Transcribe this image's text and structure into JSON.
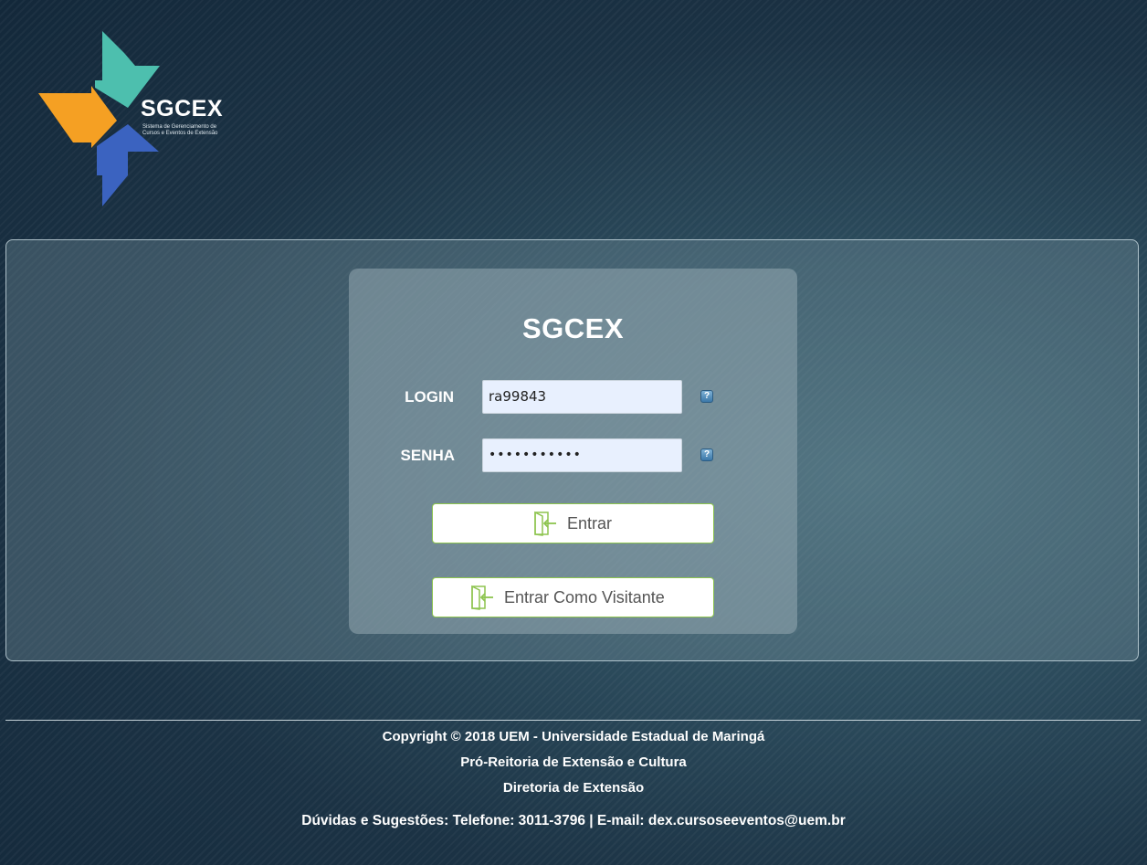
{
  "logo": {
    "title": "SGCEX",
    "subtitle": "Sistema de Gerenciamento de Cursos e Eventos de Extensão",
    "colors": {
      "teal": "#4dbfae",
      "orange": "#f5a023",
      "blue": "#3b63c0"
    }
  },
  "login_form": {
    "title": "SGCEX",
    "login_label": "LOGIN",
    "login_value": "ra99843",
    "senha_label": "SENHA",
    "senha_value": "•••••••••••",
    "help_icon": "?",
    "entrar_label": "Entrar",
    "visitante_label": "Entrar Como Visitante",
    "button_icon": "door-enter-icon",
    "accent_color": "#8dc44f"
  },
  "footer": {
    "copyright": "Copyright © 2018 UEM - Universidade Estadual de Maringá",
    "line2": "Pró-Reitoria de Extensão e Cultura",
    "line3": "Diretoria de Extensão",
    "contact": "Dúvidas e Sugestões: Telefone: 3011-3796 | E-mail: dex.cursoseeventos@uem.br"
  }
}
